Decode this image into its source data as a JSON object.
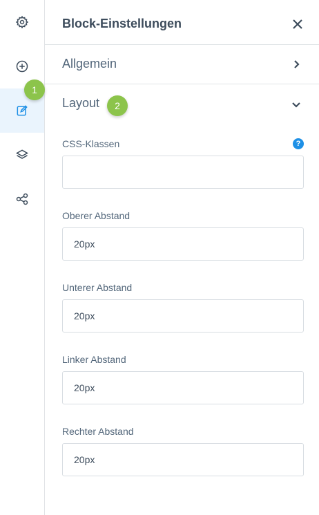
{
  "rail": {
    "items": [
      {
        "name": "settings",
        "icon": "gear-icon"
      },
      {
        "name": "add",
        "icon": "plus-circle-icon"
      },
      {
        "name": "edit",
        "icon": "edit-icon",
        "active": true
      },
      {
        "name": "layers",
        "icon": "layers-icon"
      },
      {
        "name": "share",
        "icon": "share-icon"
      }
    ]
  },
  "badges": {
    "one": "1",
    "two": "2"
  },
  "panel": {
    "title": "Block-Einstellungen",
    "close_icon": "close-icon",
    "sections": {
      "general": "Allgemein",
      "layout": "Layout"
    }
  },
  "fields": {
    "css_classes": {
      "label": "CSS-Klassen",
      "value": "",
      "help": "?"
    },
    "top_spacing": {
      "label": "Oberer Abstand",
      "value": "20px"
    },
    "bottom_spacing": {
      "label": "Unterer Abstand",
      "value": "20px"
    },
    "left_spacing": {
      "label": "Linker Abstand",
      "value": "20px"
    },
    "right_spacing": {
      "label": "Rechter Abstand",
      "value": "20px"
    }
  },
  "colors": {
    "accent": "#1e90e6",
    "badge": "#8cc44b",
    "active_bg": "#eaf4fd"
  }
}
